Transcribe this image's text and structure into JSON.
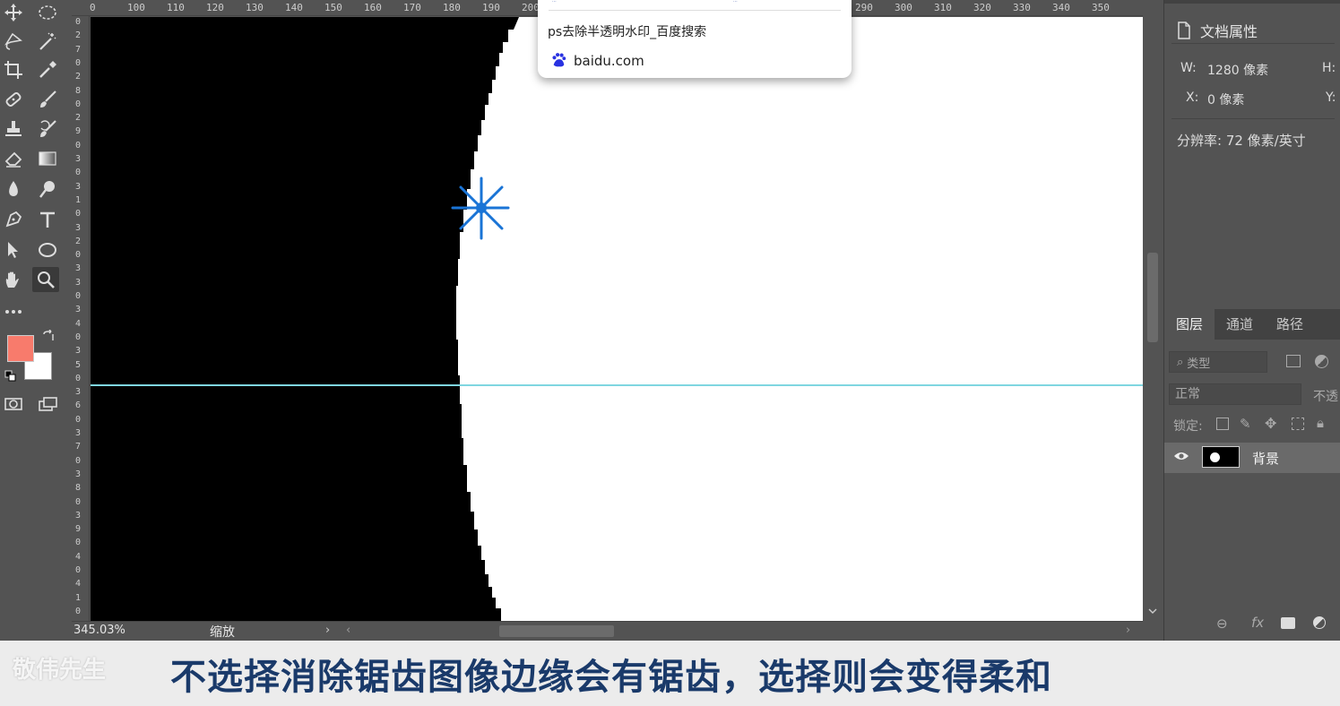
{
  "ruler": {
    "top_labels": [
      "0",
      "100",
      "110",
      "120",
      "130",
      "140",
      "150",
      "160",
      "170",
      "180",
      "190",
      "200",
      "290",
      "300",
      "310",
      "320",
      "330",
      "340",
      "350"
    ],
    "left_digits": [
      "0",
      "2",
      "7",
      "0",
      "2",
      "8",
      "0",
      "2",
      "9",
      "0",
      "3",
      "0",
      "3",
      "1",
      "0",
      "3",
      "2",
      "0",
      "3",
      "3",
      "0",
      "3",
      "4",
      "0",
      "3",
      "5",
      "0",
      "3",
      "6",
      "0",
      "3",
      "7",
      "0",
      "3",
      "8",
      "0",
      "3",
      "9",
      "0",
      "4",
      "0",
      "4",
      "1",
      "0"
    ]
  },
  "status": {
    "zoom": "345.03%",
    "label": "缩放"
  },
  "popup": {
    "title": "ps去除半透明水印_百度搜索",
    "domain": "baidu.com",
    "preview_left": "...",
    "preview_right": "..."
  },
  "properties": {
    "title": "文档属性",
    "w_label": "W:",
    "w_value": "1280 像素",
    "h_label": "H:",
    "x_label": "X:",
    "x_value": "0 像素",
    "y_label": "Y:",
    "resolution": "分辨率: 72 像素/英寸"
  },
  "layers": {
    "tabs": [
      "图层",
      "通道",
      "路径"
    ],
    "filter_label": "类型",
    "blend_mode": "正常",
    "opacity_label": "不透",
    "lock_label": "锁定:",
    "layer_name": "背景"
  },
  "colors": {
    "foreground": "#f87b6c",
    "background": "#ffffff",
    "guide": "#7fd6e0",
    "accent": "#1a74d6"
  },
  "subtitle": {
    "text": "不选择消除锯齿图像边缘会有锯齿，选择则会变得柔和",
    "watermark": "敬伟先生"
  }
}
